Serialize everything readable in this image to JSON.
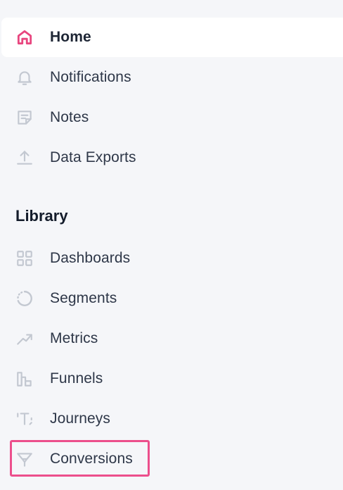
{
  "nav": {
    "home": "Home",
    "notifications": "Notifications",
    "notes": "Notes",
    "data_exports": "Data Exports"
  },
  "library": {
    "title": "Library",
    "dashboards": "Dashboards",
    "segments": "Segments",
    "metrics": "Metrics",
    "funnels": "Funnels",
    "journeys": "Journeys",
    "conversions": "Conversions"
  },
  "colors": {
    "accent": "#e8467f",
    "icon_muted": "#c3c8d1",
    "highlight": "#ec4f8c"
  }
}
